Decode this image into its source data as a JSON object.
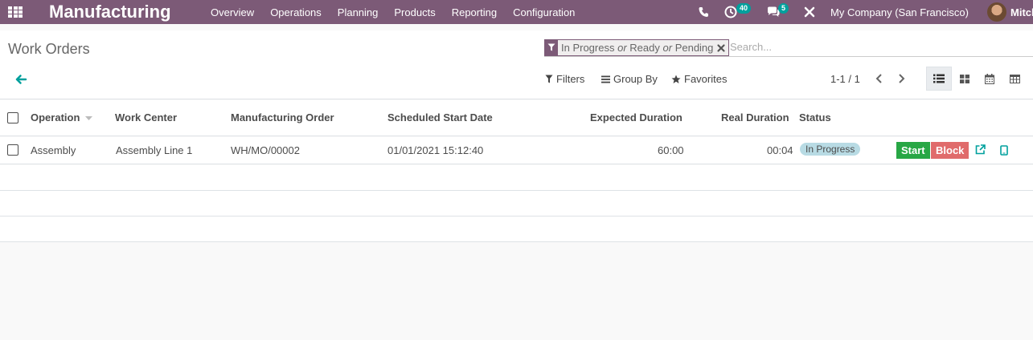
{
  "navbar": {
    "brand": "Manufacturing",
    "menu": [
      "Overview",
      "Operations",
      "Planning",
      "Products",
      "Reporting",
      "Configuration"
    ],
    "activity_count": "40",
    "message_count": "5",
    "company": "My Company (San Francisco)",
    "user": "Mitch",
    "color": "#7c5a77"
  },
  "control_panel": {
    "breadcrumb": "Work Orders",
    "facet": {
      "part1": "In Progress",
      "sep1": "or",
      "part2": "Ready",
      "sep2": "or",
      "part3": "Pending"
    },
    "search_placeholder": "Search...",
    "filters_label": "Filters",
    "group_by_label": "Group By",
    "favorites_label": "Favorites",
    "pager": "1-1 / 1"
  },
  "table": {
    "headers": {
      "operation": "Operation",
      "work_center": "Work Center",
      "manufacturing_order": "Manufacturing Order",
      "scheduled_start": "Scheduled Start Date",
      "expected_duration": "Expected Duration",
      "real_duration": "Real Duration",
      "status": "Status"
    },
    "rows": [
      {
        "operation": "Assembly",
        "work_center": "Assembly Line 1",
        "manufacturing_order": "WH/MO/00002",
        "scheduled_start": "01/01/2021 15:12:40",
        "expected_duration": "60:00",
        "real_duration": "00:04",
        "status": "In Progress",
        "start_label": "Start",
        "block_label": "Block"
      }
    ]
  },
  "colors": {
    "accent": "#00a09d",
    "start": "#28a745",
    "block": "#e06b6b",
    "status_badge": "#b8dbe4"
  }
}
